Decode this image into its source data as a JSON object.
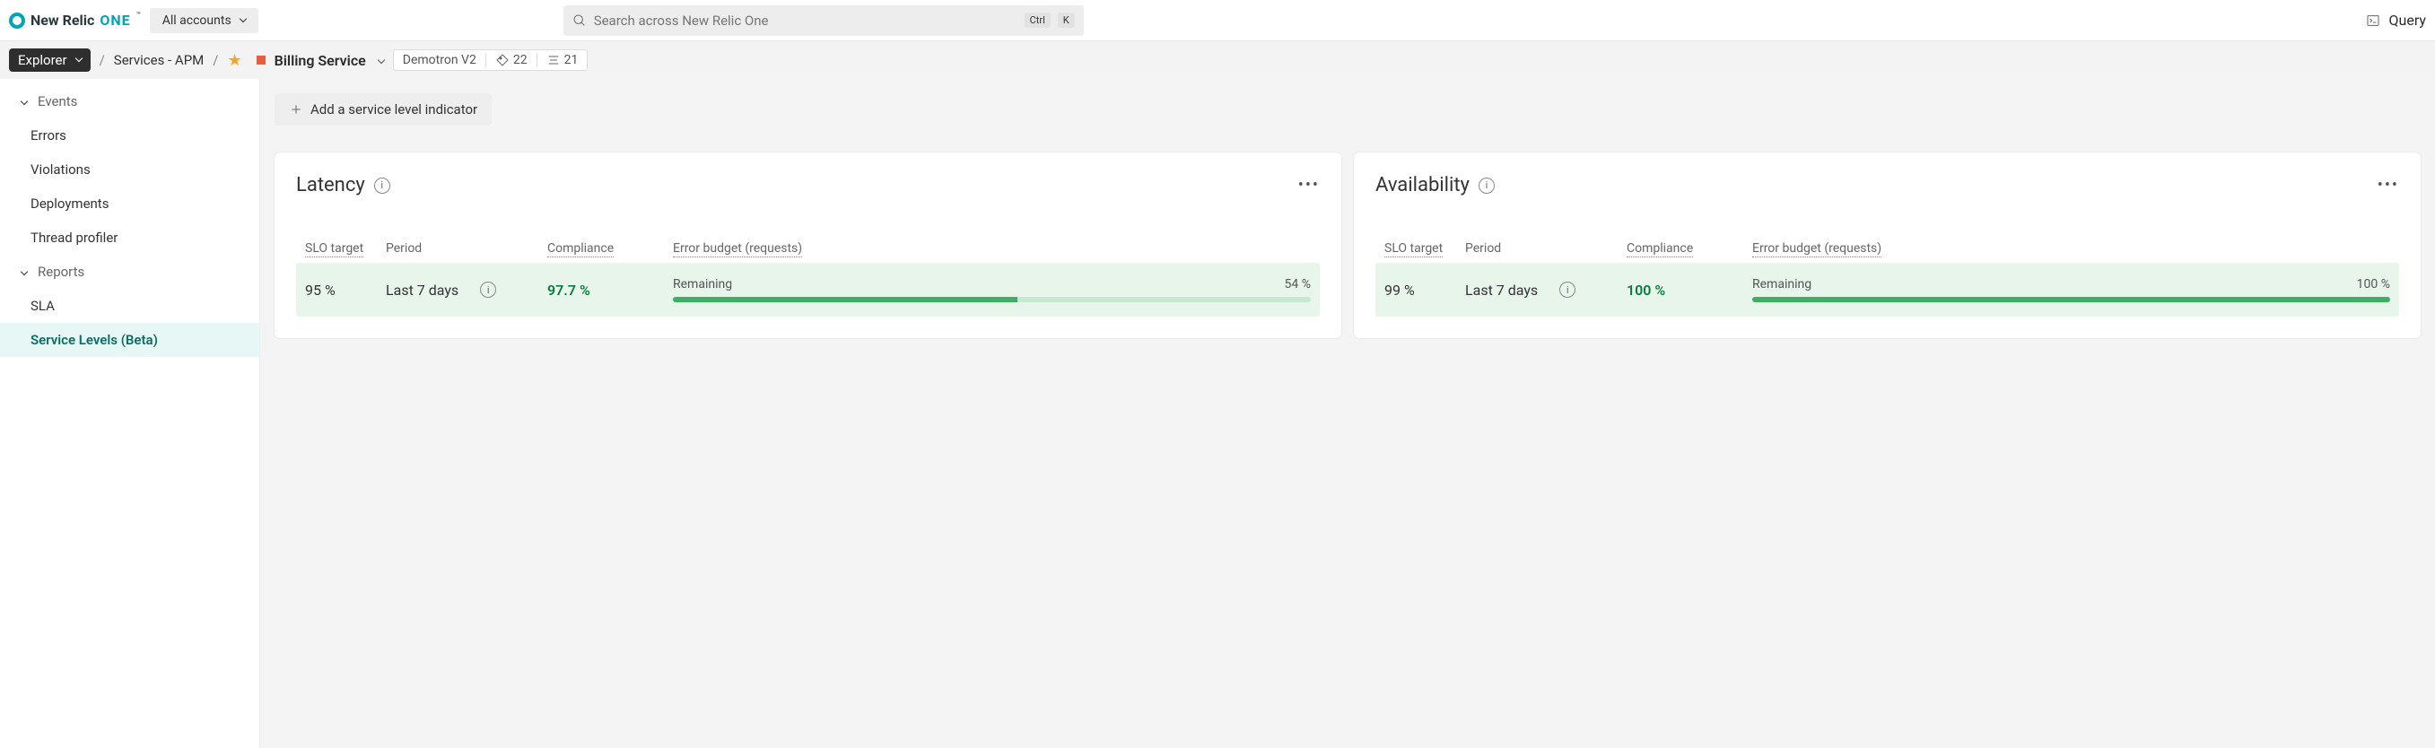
{
  "header": {
    "logo_text": "New Relic",
    "logo_suffix": "ONE",
    "tm": "™",
    "accounts_label": "All accounts",
    "search_placeholder": "Search across New Relic One",
    "kbd_ctrl": "Ctrl",
    "kbd_k": "K",
    "query_label": "Query"
  },
  "breadcrumb": {
    "explorer": "Explorer",
    "services": "Services - APM",
    "service_name": "Billing Service",
    "account": "Demotron V2",
    "tag_count": "22",
    "related_count": "21"
  },
  "sidebar": {
    "events_header": "Events",
    "errors": "Errors",
    "violations": "Violations",
    "deployments": "Deployments",
    "thread_profiler": "Thread profiler",
    "reports_header": "Reports",
    "sla": "SLA",
    "service_levels": "Service Levels (Beta)"
  },
  "main": {
    "add_sli": "Add a service level indicator"
  },
  "headers": {
    "slo_target": "SLO target",
    "period": "Period",
    "compliance": "Compliance",
    "error_budget": "Error budget (requests)",
    "remaining": "Remaining"
  },
  "cards": [
    {
      "title": "Latency",
      "slo_target": "95 %",
      "period": "Last 7 days",
      "compliance": "97.7 %",
      "remaining_pct": "54 %",
      "bar_fill": 54
    },
    {
      "title": "Availability",
      "slo_target": "99 %",
      "period": "Last 7 days",
      "compliance": "100 %",
      "remaining_pct": "100 %",
      "bar_fill": 100
    }
  ]
}
